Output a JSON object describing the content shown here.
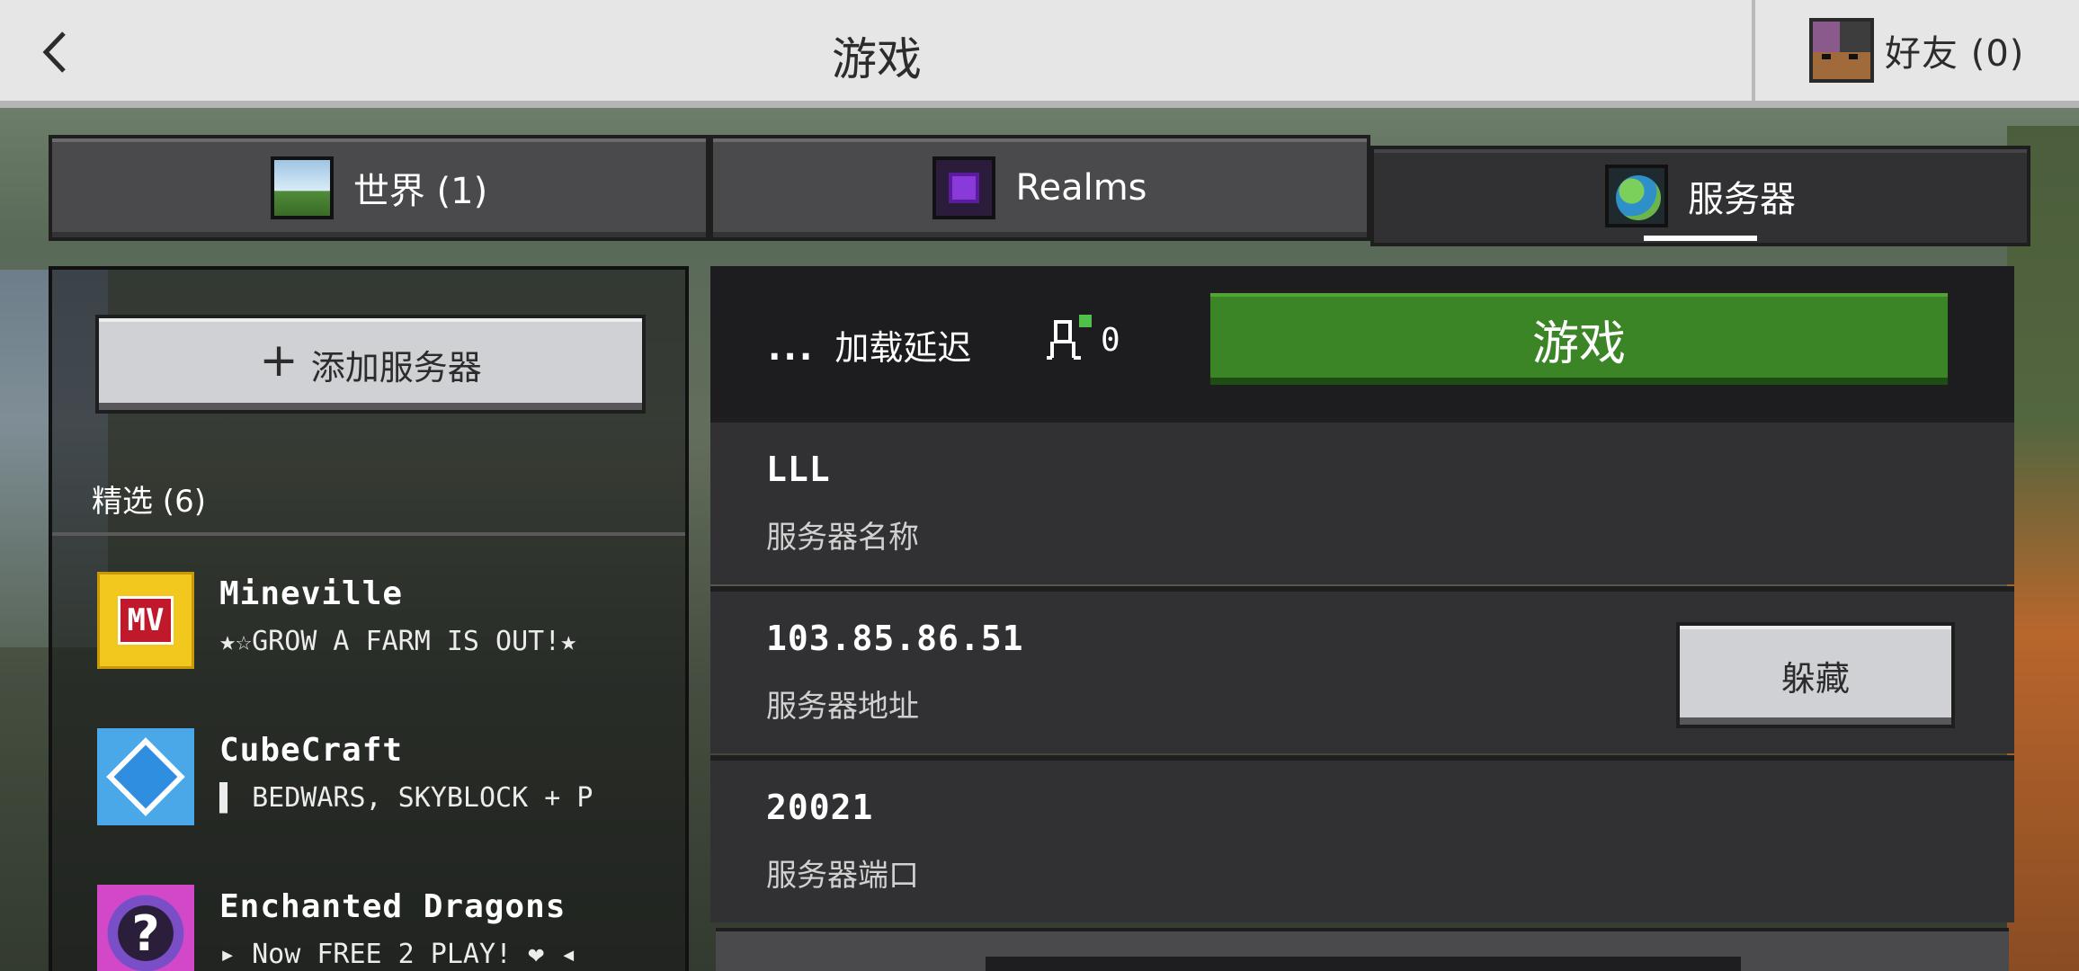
{
  "header": {
    "title": "游戏",
    "friends_label": "好友 (0)"
  },
  "tabs": [
    {
      "label": "世界 (1)",
      "icon": "world-icon"
    },
    {
      "label": "Realms",
      "icon": "realms-icon"
    },
    {
      "label": "服务器",
      "icon": "server-globe-icon",
      "active": true
    }
  ],
  "sidebar": {
    "add_server_label": "添加服务器",
    "featured_label": "精选 (6)",
    "servers": [
      {
        "name": "Mineville",
        "motd": "★☆GROW A FARM IS OUT!★",
        "icon_text": "MV"
      },
      {
        "name": "CubeCraft",
        "motd": "▌ BEDWARS, SKYBLOCK + P"
      },
      {
        "name": "Enchanted Dragons",
        "motd": "▸ Now FREE 2 PLAY! ❤ ◂",
        "icon_text": "?"
      }
    ]
  },
  "details": {
    "latency_dots": "...",
    "latency_label": "加载延迟",
    "player_count": "0",
    "play_label": "游戏",
    "fields": [
      {
        "value": "LLL",
        "label": "服务器名称"
      },
      {
        "value": "103.85.86.51",
        "label": "服务器地址"
      },
      {
        "value": "20021",
        "label": "服务器端口"
      }
    ],
    "hide_label": "躲藏"
  },
  "colors": {
    "play_green": "#3c8527",
    "header_bg": "#e6e6e6",
    "panel_dark": "#313133"
  }
}
